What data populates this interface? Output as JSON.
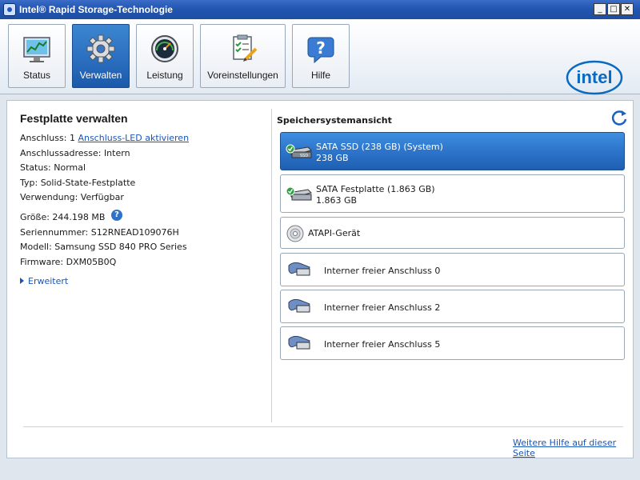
{
  "window": {
    "title": "Intel® Rapid Storage-Technologie"
  },
  "toolbar": {
    "tabs": [
      {
        "label": "Status",
        "icon": "status-icon"
      },
      {
        "label": "Verwalten",
        "icon": "gear-icon",
        "active": true
      },
      {
        "label": "Leistung",
        "icon": "gauge-icon"
      },
      {
        "label": "Voreinstellungen",
        "icon": "preferences-icon"
      },
      {
        "label": "Hilfe",
        "icon": "help-icon"
      }
    ],
    "brand": "intel"
  },
  "details": {
    "title": "Festplatte verwalten",
    "port_label": "Anschluss: 1",
    "port_led_link": "Anschluss-LED aktivieren",
    "address": "Anschlussadresse: Intern",
    "status": "Status: Normal",
    "type": "Typ: Solid-State-Festplatte",
    "usage": "Verwendung: Verfügbar",
    "size": "Größe: 244.198 MB",
    "serial": "Seriennummer: S12RNEAD109076H",
    "model": "Modell: Samsung SSD 840 PRO Series",
    "firmware": "Firmware: DXM05B0Q",
    "extended": "Erweitert"
  },
  "storage_view": {
    "title": "Speichersystemansicht",
    "devices": [
      {
        "name": "SATA SSD (238 GB) (System)",
        "size": "238 GB",
        "selected": true
      },
      {
        "name": "SATA Festplatte (1.863 GB)",
        "size": "1.863 GB"
      },
      {
        "name": "ATAPI-Gerät"
      },
      {
        "name": "Interner freier Anschluss 0"
      },
      {
        "name": "Interner freier Anschluss 2"
      },
      {
        "name": "Interner freier Anschluss 5"
      }
    ]
  },
  "footer": {
    "help_link": "Weitere Hilfe auf dieser Seite"
  },
  "colors": {
    "accent": "#2b72c8",
    "link": "#1a55b8",
    "titlebar": "#2356b0"
  }
}
